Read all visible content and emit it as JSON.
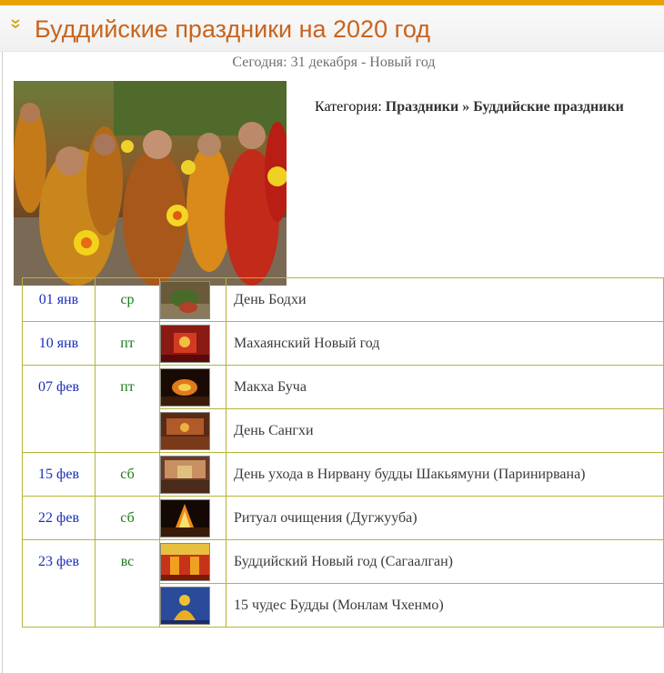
{
  "header": {
    "title": "Буддийские праздники на 2020 год",
    "accent_color": "#e8a200",
    "title_color": "#c8641e",
    "icon": "double-chevron-down-icon"
  },
  "today": "Сегодня: 31 декабря - Новый год",
  "category": {
    "label": "Категория:",
    "path_1": "Праздники",
    "separator": "»",
    "path_2": "Буддийские праздники"
  },
  "photo": {
    "icon": "photo-monks-procession"
  },
  "holidays": [
    {
      "date": "01 янв",
      "weekday": "ср",
      "names": [
        "День Бодхи"
      ]
    },
    {
      "date": "10 янв",
      "weekday": "пт",
      "names": [
        "Махаянский Новый год"
      ]
    },
    {
      "date": "07 фев",
      "weekday": "пт",
      "names": [
        "Макха Буча",
        "День Сангхи"
      ]
    },
    {
      "date": "15 фев",
      "weekday": "сб",
      "names": [
        "День ухода в Нирвану будды Шакьямуни (Паринирвана)"
      ]
    },
    {
      "date": "22 фев",
      "weekday": "сб",
      "names": [
        "Ритуал очищения (Дугжууба)"
      ]
    },
    {
      "date": "23 фев",
      "weekday": "вс",
      "names": [
        "Буддийский Новый год (Сагаалган)",
        "15 чудес Будды (Монлам Чхенмо)"
      ]
    }
  ]
}
